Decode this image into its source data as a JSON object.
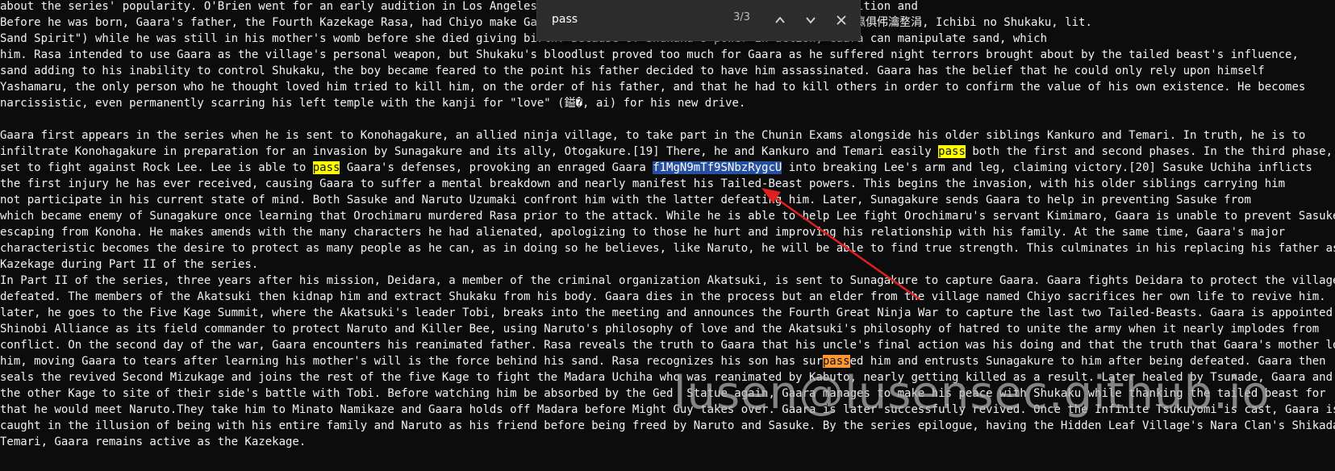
{
  "document": {
    "lines": [
      {
        "text": "about the series' popularity. O'Brien went for an early audition in Los Angeles, however, Brien later went through another audition and"
      },
      {
        "text": "Before he was born, Gaara's father, the Fourth Kazekage Rasa, had Chiyo make Gaara the jinchuriki of Shukaku the One Tail (涓€瀛俱伄瀹堥涓, Ichibi no Shukaku, lit."
      },
      {
        "text": "Sand Spirit\") while he was still in his mother's womb before she died giving birth. Because of Shukaku's power in action, Gaara can manipulate sand, which"
      },
      {
        "text": "him. Rasa intended to use Gaara as the village's personal weapon, but Shukaku's bloodlust proved too much for Gaara as he suffered night terrors brought about by the tailed beast's influence,"
      },
      {
        "text": "sand adding to his inability to control Shukaku, the boy became feared to the point his father decided to have him assassinated. Gaara has the belief that he could only rely upon himself"
      },
      {
        "text": "Yashamaru, the only person who he thought loved him tried to kill him, on the order of his father, and that he had to kill others in order to confirm the value of his own existence. He becomes"
      },
      {
        "text": "narcissistic, even permanently scarring his left temple with the kanji for \"love\" (鎰�, ai) for his new drive."
      },
      {
        "text": ""
      },
      {
        "text": "Gaara first appears in the series when he is sent to Konohagakure, an allied ninja village, to take part in the Chunin Exams alongside his older siblings Kankuro and Temari. In truth, he is to"
      },
      {
        "text": "infiltrate Konohagakure in preparation for an invasion by Sunagakure and its ally, Otogakure.[19] There, he and Kankuro and Temari easily ",
        "hl": "pass",
        "after": " both the first and second phases. In the third phase, he is"
      },
      {
        "text": "set to fight against Rock Lee. Lee is able to ",
        "hl": "pass",
        "after": " Gaara's defenses, provoking an enraged Gaara ",
        "sel": "f1MgN9mTf9SNbzRygcU",
        "after2": " into breaking Lee's arm and leg, claiming victory.[20] Sasuke Uchiha inflicts"
      },
      {
        "text": "the first injury he has ever received, causing Gaara to suffer a mental breakdown and nearly manifest his Tailed-Beast powers. This begins the invasion, with his older siblings carrying him"
      },
      {
        "text": "not participate in his current state of mind. Both Sasuke and Naruto Uzumaki confront him with the latter defeating him. Later, Sunagakure sends Gaara to help in preventing Sasuke from"
      },
      {
        "text": "which became enemy of Sunagakure once learning that Orochimaru murdered Rasa prior to the attack. While he is able to help Lee fight Orochimaru's servant Kimimaro, Gaara is unable to prevent Sasuke"
      },
      {
        "text": "escaping from Konoha. He makes amends with the many characters he had alienated, apologizing to those he hurt and improving his relationship with his family. At the same time, Gaara's major"
      },
      {
        "text": "characteristic becomes the desire to protect as many people as he can, as in doing so he believes, like Naruto, he will be able to find true strength. This culminates in his replacing his father as"
      },
      {
        "text": "Kazekage during Part II of the series."
      },
      {
        "text": "In Part II of the series, three years after his mission, Deidara, a member of the criminal organization Akatsuki, is sent to Sunagakure to capture Gaara. Gaara fights Deidara to protect the village and is"
      },
      {
        "text": "defeated. The members of the Akatsuki then kidnap him and extract Shukaku from his body. Gaara dies in the process but an elder from the village named Chiyo sacrifices her own life to revive him."
      },
      {
        "text": "later, he goes to the Five Kage Summit, where the Akatsuki's leader Tobi, breaks into the meeting and announces the Fourth Great Ninja War to capture the last two Tailed-Beasts. Gaara is appointed"
      },
      {
        "text": "Shinobi Alliance as its field commander to protect Naruto and Killer Bee, using Naruto's philosophy of love and the Akatsuki's philosophy of hatred to unite the army when it nearly implodes from"
      },
      {
        "text": "conflict. On the second day of the war, Gaara encounters his reanimated father. Rasa reveals the truth to Gaara that his uncle's final action was his doing and that the truth that Gaara's mother loved"
      },
      {
        "text": "him, moving Gaara to tears after learning his mother's will is the force behind his sand. Rasa recognizes his son has sur",
        "hlc": "pass",
        "after": "ed him and entrusts Sunagakure to him after being defeated. Gaara then"
      },
      {
        "text": "seals the revived Second Mizukage and joins the rest of the five Kage to fight the Madara Uchiha who was reanimated by Kabuto, nearly getting killed as a result. Later healed by Tsunade, Gaara and"
      },
      {
        "text": "the other Kage to site of their side's battle with Tobi. Before watching him be absorbed by the Ged  Statue again, Gaara manages to make his peace with Shukaku while thanking the tailed beast for"
      },
      {
        "text": "that he would meet Naruto.They take him to Minato Namikaze and Gaara holds off Madara before Might Guy takes over. Gaara is later successfully revived. Once the Infinite Tsukuyomi is cast, Gaara is"
      },
      {
        "text": "caught in the illusion of being with his entire family and Naruto as his friend before being freed by Naruto and Sasuke. By the series epilogue, having the Hidden Leaf Village's Nara Clan's Shikadai,"
      },
      {
        "text": "Temari, Gaara remains active as the Kazekage."
      },
      {
        "text": ""
      }
    ]
  },
  "find_bar": {
    "query": "pass",
    "count": "3/3",
    "prev_icon": "chevron-up-icon",
    "next_icon": "chevron-down-icon",
    "close_icon": "close-icon"
  },
  "watermark": {
    "text": "lusen@lusensec.github.io"
  },
  "colors": {
    "background": "#0c0c0c",
    "text": "#f2f2f2",
    "match_highlight": "#ffff00",
    "current_match": "#ff9632",
    "selection": "#264f9f",
    "arrow": "#e02020"
  }
}
